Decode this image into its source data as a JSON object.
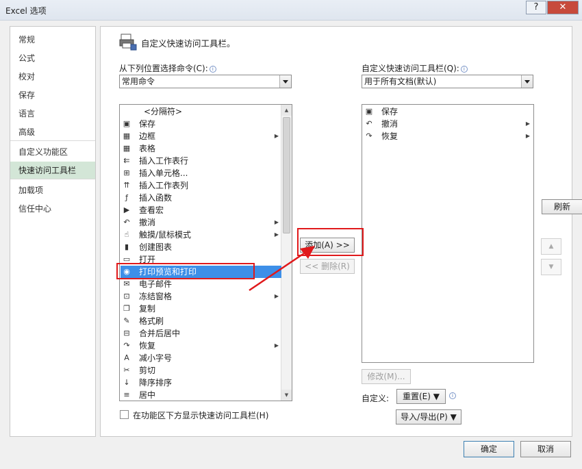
{
  "window": {
    "title": "Excel 选项",
    "help": "?",
    "close": "✕"
  },
  "nav": {
    "items": [
      "常规",
      "公式",
      "校对",
      "保存",
      "语言",
      "高级",
      "自定义功能区",
      "快速访问工具栏",
      "加载项",
      "信任中心"
    ],
    "active_index": 7
  },
  "header": {
    "text": "自定义快速访问工具栏。"
  },
  "left": {
    "label": "从下列位置选择命令(C):",
    "combo_value": "常用命令",
    "items": [
      {
        "icon": "",
        "label": "<分隔符>",
        "sub": false
      },
      {
        "icon": "save-icon",
        "label": "保存",
        "sub": false
      },
      {
        "icon": "border-icon",
        "label": "边框",
        "sub": true
      },
      {
        "icon": "table-icon",
        "label": "表格",
        "sub": false
      },
      {
        "icon": "insert-row-icon",
        "label": "插入工作表行",
        "sub": false
      },
      {
        "icon": "insert-cells-icon",
        "label": "插入单元格...",
        "sub": false
      },
      {
        "icon": "insert-column-icon",
        "label": "插入工作表列",
        "sub": false
      },
      {
        "icon": "function-icon",
        "label": "插入函数",
        "sub": false
      },
      {
        "icon": "macro-icon",
        "label": "查看宏",
        "sub": false
      },
      {
        "icon": "undo-icon",
        "label": "撤消",
        "sub": true
      },
      {
        "icon": "touch-icon",
        "label": "触摸/鼠标模式",
        "sub": true
      },
      {
        "icon": "chart-icon",
        "label": "创建图表",
        "sub": false
      },
      {
        "icon": "folder-icon",
        "label": "打开",
        "sub": false
      },
      {
        "icon": "print-preview-icon",
        "label": "打印预览和打印",
        "sub": false
      },
      {
        "icon": "email-icon",
        "label": "电子邮件",
        "sub": false
      },
      {
        "icon": "freeze-panes-icon",
        "label": "冻结窗格",
        "sub": true
      },
      {
        "icon": "copy-icon",
        "label": "复制",
        "sub": false
      },
      {
        "icon": "format-painter-icon",
        "label": "格式刷",
        "sub": false
      },
      {
        "icon": "merge-center-icon",
        "label": "合并后居中",
        "sub": false
      },
      {
        "icon": "redo-icon",
        "label": "恢复",
        "sub": true
      },
      {
        "icon": "decrease-font-icon",
        "label": "减小字号",
        "sub": false
      },
      {
        "icon": "cut-icon",
        "label": "剪切",
        "sub": false
      },
      {
        "icon": "sort-desc-icon",
        "label": "降序排序",
        "sub": false
      },
      {
        "icon": "center-icon",
        "label": "居中",
        "sub": false
      }
    ],
    "selected_index": 13
  },
  "right": {
    "label": "自定义快速访问工具栏(Q):",
    "combo_value": "用于所有文档(默认)",
    "items": [
      {
        "icon": "save-icon",
        "label": "保存",
        "sub": false
      },
      {
        "icon": "undo-icon",
        "label": "撤消",
        "sub": true
      },
      {
        "icon": "redo-icon",
        "label": "恢复",
        "sub": true
      }
    ]
  },
  "buttons": {
    "add": "添加(A) >>",
    "remove": "<< 删除(R)",
    "modify": "修改(M)...",
    "customize_label": "自定义:",
    "reset": "重置(E) ▼",
    "import_export": "导入/导出(P) ▼",
    "refresh": "刷新",
    "ok": "确定",
    "cancel": "取消",
    "move_up": "▲",
    "move_down": "▼"
  },
  "checkbox": {
    "label": "在功能区下方显示快速访问工具栏(H)",
    "checked": false
  }
}
